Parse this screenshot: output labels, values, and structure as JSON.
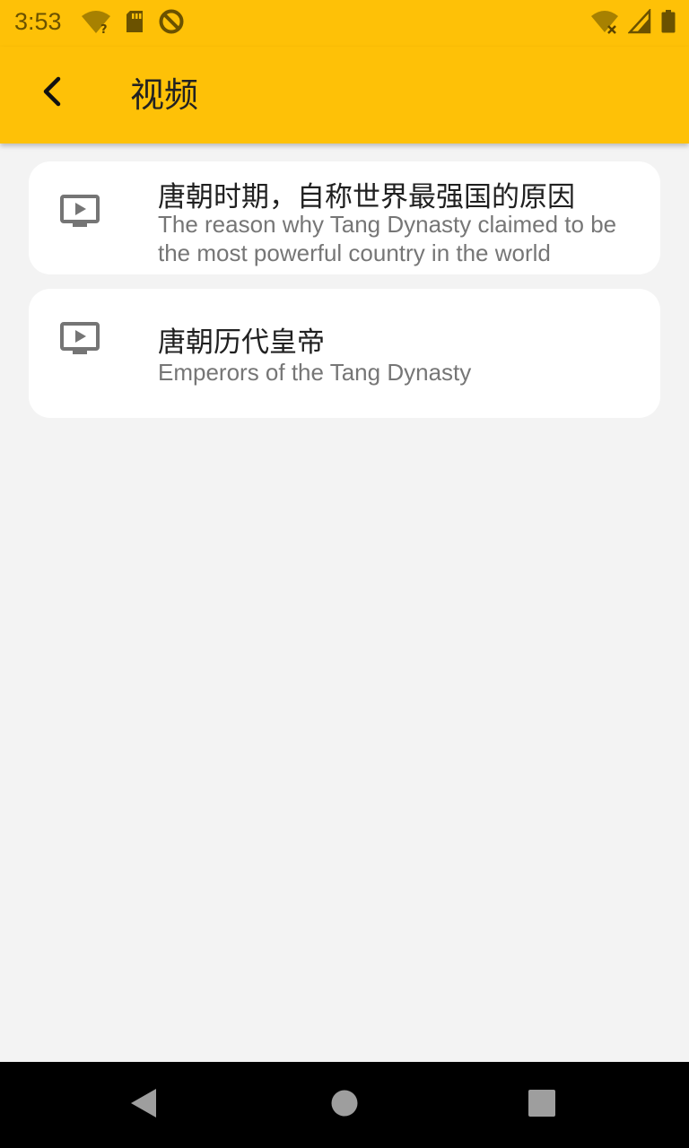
{
  "status_bar": {
    "time": "3:53",
    "left_icons": [
      "wifi-unknown-icon",
      "sd-card-icon",
      "sync-blocked-icon"
    ],
    "right_icons": [
      "wifi-off-icon",
      "signal-icon",
      "battery-icon"
    ]
  },
  "app_bar": {
    "back_icon": "back-arrow-icon",
    "title": "视频"
  },
  "videos": [
    {
      "icon": "video-play-icon",
      "title": "唐朝时期，自称世界最强国的原因",
      "subtitle": "The reason why Tang Dynasty claimed to be the most powerful country in the world"
    },
    {
      "icon": "video-play-icon",
      "title": "唐朝历代皇帝",
      "subtitle": "Emperors of the Tang Dynasty"
    }
  ],
  "nav_bar": {
    "buttons": [
      "back-triangle-icon",
      "home-circle-icon",
      "recents-square-icon"
    ]
  },
  "colors": {
    "app_bar": "#fec107",
    "background": "#f3f3f3",
    "card": "#ffffff",
    "icon": "#757575"
  }
}
